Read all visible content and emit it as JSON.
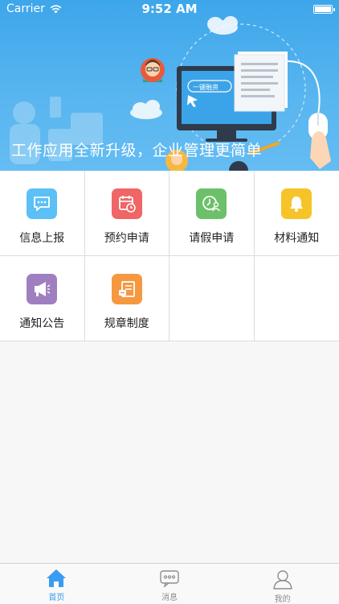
{
  "status_bar": {
    "carrier": "Carrier",
    "time": "9:52 AM"
  },
  "banner": {
    "slogan": "工作应用全新升级，企业管理更简单",
    "screen_text": "一键融资"
  },
  "grid": {
    "items": [
      {
        "label": "信息上报",
        "icon": "chat-bubble-icon",
        "color": "#5bc0f5"
      },
      {
        "label": "预约申请",
        "icon": "calendar-clock-icon",
        "color": "#f06565"
      },
      {
        "label": "请假申请",
        "icon": "clock-person-icon",
        "color": "#6cc06a"
      },
      {
        "label": "材料通知",
        "icon": "bell-icon",
        "color": "#f6c428"
      },
      {
        "label": "通知公告",
        "icon": "megaphone-icon",
        "color": "#a07fc0"
      },
      {
        "label": "规章制度",
        "icon": "document-icon",
        "color": "#f6983f"
      }
    ]
  },
  "tabbar": {
    "tabs": [
      {
        "label": "首页",
        "icon": "home-icon",
        "active": true
      },
      {
        "label": "消息",
        "icon": "message-icon",
        "active": false
      },
      {
        "label": "我的",
        "icon": "user-icon",
        "active": false
      }
    ],
    "accent": "#3a9cf0"
  }
}
